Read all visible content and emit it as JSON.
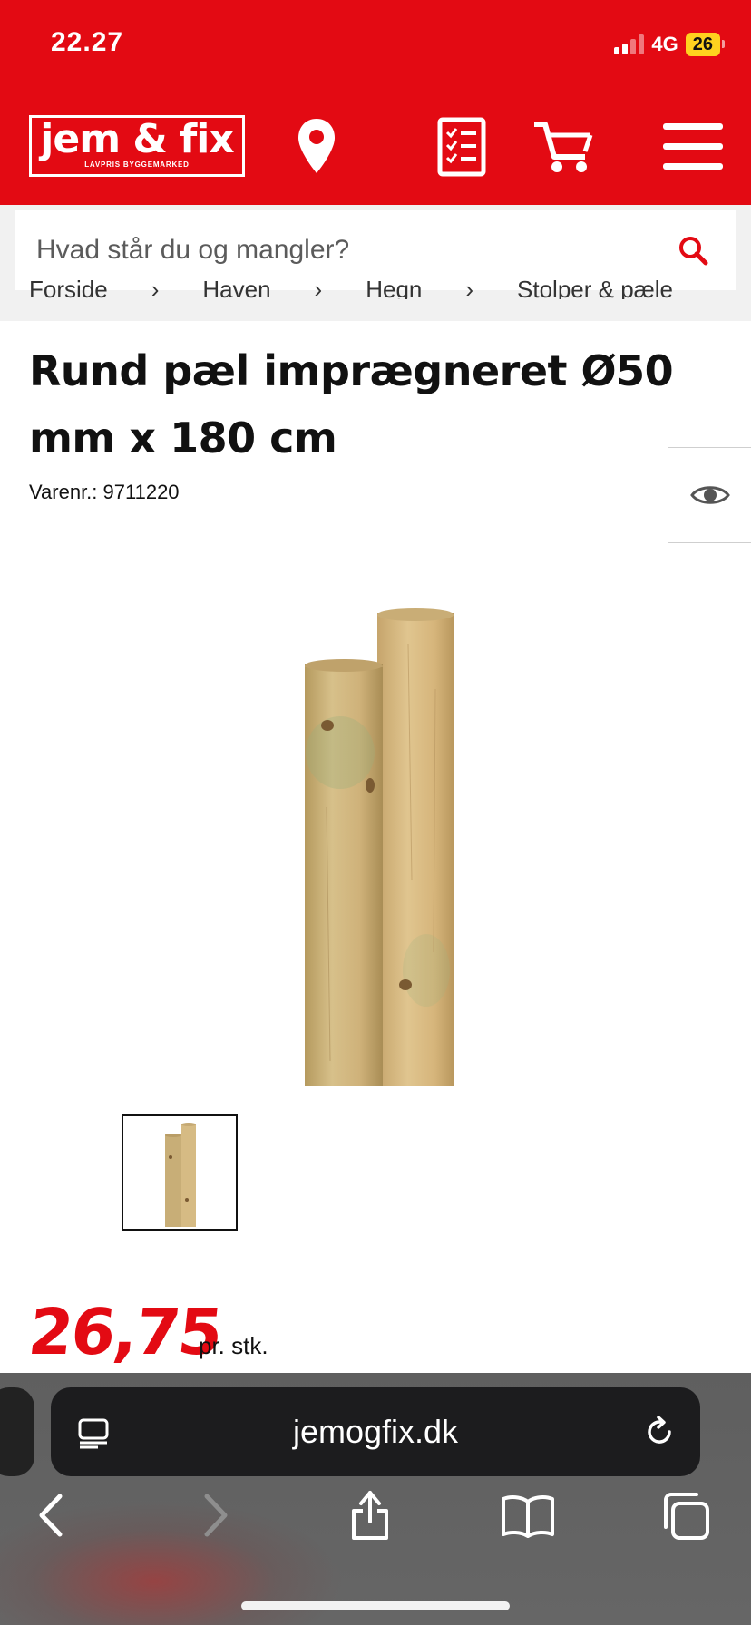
{
  "status": {
    "time": "22.27",
    "network": "4G",
    "battery": "26"
  },
  "header": {
    "logo_main": "jem & fix",
    "logo_sub": "LAVPRIS BYGGEMARKED",
    "icons": [
      "location-pin-icon",
      "shopping-list-icon",
      "cart-icon",
      "menu-icon"
    ],
    "brand_color": "#e30a13"
  },
  "search": {
    "placeholder": "Hvad står du og mangler?",
    "icon": "search-icon"
  },
  "breadcrumb": [
    "Forside",
    "›",
    "Haven",
    "›",
    "Hegn",
    "›",
    "Stolper & pæle"
  ],
  "product": {
    "title": "Rund pæl imprægneret Ø50 mm x 180 cm",
    "sku": "Varenr.: 9711220",
    "price": "26,75",
    "unit": "pr. stk."
  },
  "browser": {
    "url": "jemogfix.dk"
  }
}
